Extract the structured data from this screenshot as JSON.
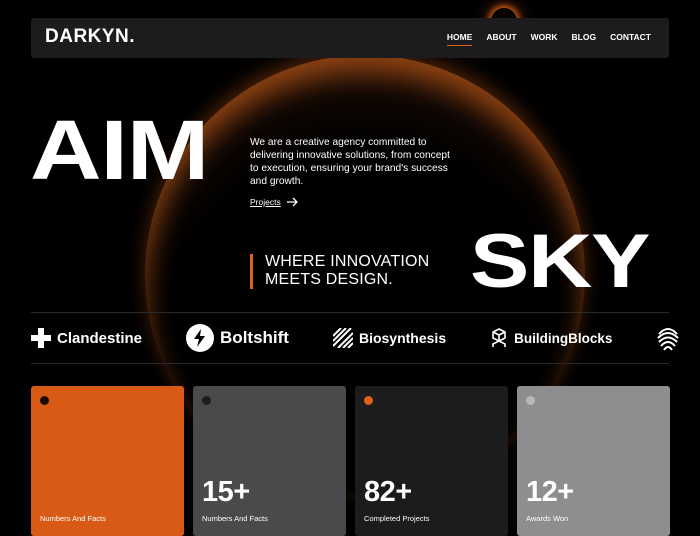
{
  "header": {
    "logo": "DARKYN.",
    "nav": [
      {
        "label": "HOME",
        "active": true
      },
      {
        "label": "ABOUT",
        "active": false
      },
      {
        "label": "WORK",
        "active": false
      },
      {
        "label": "BLOG",
        "active": false
      },
      {
        "label": "CONTACT",
        "active": false
      }
    ]
  },
  "hero": {
    "headline_left": "AIM",
    "headline_right": "SKY",
    "description": "We are a creative agency committed to delivering innovative solutions, from concept to execution, ensuring your brand's success and growth.",
    "cta_label": "Projects",
    "cta_icon": "arrow-right-icon",
    "tagline_line1": "WHERE INNOVATION",
    "tagline_line2": "MEETS DESIGN.",
    "accent_color": "#e0601a"
  },
  "brands": [
    {
      "name": "Clandestine",
      "icon": "cross-icon"
    },
    {
      "name": "Boltshift",
      "icon": "bolt-icon"
    },
    {
      "name": "Biosynthesis",
      "icon": "stripes-icon"
    },
    {
      "name": "BuildingBlocks",
      "icon": "blocks-icon"
    },
    {
      "name": "",
      "icon": "fingerprint-icon"
    }
  ],
  "stats": [
    {
      "value": "",
      "label": "Numbers And Facts",
      "bg": "#d95a14",
      "dot": "#1a0a02",
      "text": "#ffffff"
    },
    {
      "value": "15+",
      "label": "Numbers And Facts",
      "bg": "#4a4a4c",
      "dot": "#1e1e1e",
      "text": "#ffffff"
    },
    {
      "value": "82+",
      "label": "Completed Projects",
      "bg": "#1c1b1e",
      "dot": "#e0601a",
      "text": "#ffffff"
    },
    {
      "value": "12+",
      "label": "Awards Won",
      "bg": "#8e8d90",
      "dot": "#b8b8ba",
      "text": "#ffffff"
    }
  ]
}
